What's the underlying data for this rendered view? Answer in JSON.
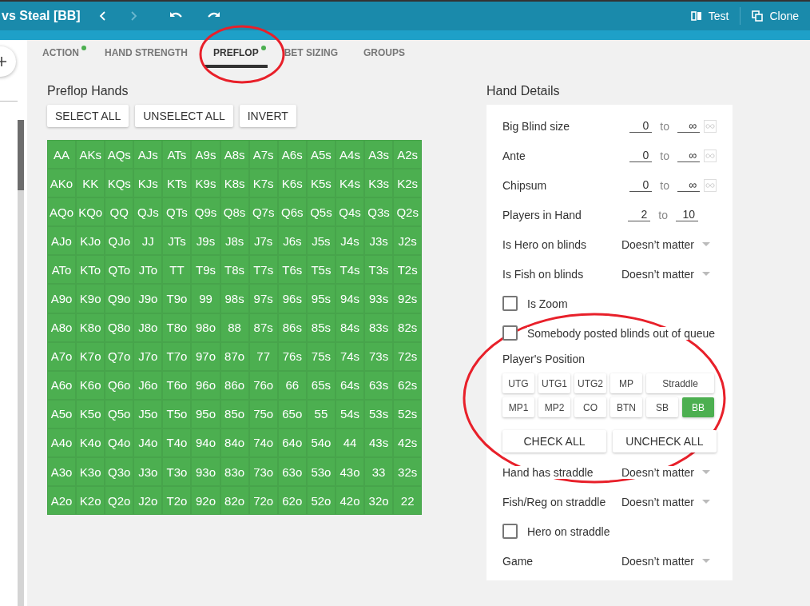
{
  "window": {
    "title": "vs Steal [BB]"
  },
  "toolbar": {
    "test": "Test",
    "clone": "Clone"
  },
  "tabs": [
    {
      "label": "ACTION",
      "dot": true,
      "selected": false
    },
    {
      "label": "HAND STRENGTH",
      "dot": false,
      "selected": false
    },
    {
      "label": "PREFLOP",
      "dot": true,
      "selected": true
    },
    {
      "label": "BET SIZING",
      "dot": false,
      "selected": false
    },
    {
      "label": "GROUPS",
      "dot": false,
      "selected": false
    }
  ],
  "hands_panel": {
    "title": "Preflop Hands",
    "buttons": [
      "SELECT ALL",
      "UNSELECT ALL",
      "INVERT"
    ],
    "rows": [
      {
        "cells": [
          {
            "label": "AA",
            "selected": true
          },
          {
            "label": "AKs",
            "selected": true
          },
          {
            "label": "AQs",
            "selected": true
          },
          {
            "label": "AJs",
            "selected": true
          },
          {
            "label": "ATs",
            "selected": true
          },
          {
            "label": "A9s",
            "selected": true
          },
          {
            "label": "A8s",
            "selected": true
          },
          {
            "label": "A7s",
            "selected": true
          },
          {
            "label": "A6s",
            "selected": true
          },
          {
            "label": "A5s",
            "selected": true
          },
          {
            "label": "A4s",
            "selected": true
          },
          {
            "label": "A3s",
            "selected": true
          },
          {
            "label": "A2s",
            "selected": true
          }
        ]
      },
      {
        "cells": [
          {
            "label": "AKo",
            "selected": true
          },
          {
            "label": "KK",
            "selected": true
          },
          {
            "label": "KQs",
            "selected": true
          },
          {
            "label": "KJs",
            "selected": true
          },
          {
            "label": "KTs",
            "selected": true
          },
          {
            "label": "K9s",
            "selected": true
          },
          {
            "label": "K8s",
            "selected": true
          },
          {
            "label": "K7s",
            "selected": true
          },
          {
            "label": "K6s",
            "selected": true
          },
          {
            "label": "K5s",
            "selected": true
          },
          {
            "label": "K4s",
            "selected": true
          },
          {
            "label": "K3s",
            "selected": true
          },
          {
            "label": "K2s",
            "selected": true
          }
        ]
      },
      {
        "cells": [
          {
            "label": "AQo",
            "selected": true
          },
          {
            "label": "KQo",
            "selected": true
          },
          {
            "label": "QQ",
            "selected": true
          },
          {
            "label": "QJs",
            "selected": true
          },
          {
            "label": "QTs",
            "selected": true
          },
          {
            "label": "Q9s",
            "selected": true
          },
          {
            "label": "Q8s",
            "selected": true
          },
          {
            "label": "Q7s",
            "selected": true
          },
          {
            "label": "Q6s",
            "selected": true
          },
          {
            "label": "Q5s",
            "selected": true
          },
          {
            "label": "Q4s",
            "selected": true
          },
          {
            "label": "Q3s",
            "selected": true
          },
          {
            "label": "Q2s",
            "selected": true
          }
        ]
      },
      {
        "cells": [
          {
            "label": "AJo",
            "selected": true
          },
          {
            "label": "KJo",
            "selected": true
          },
          {
            "label": "QJo",
            "selected": true
          },
          {
            "label": "JJ",
            "selected": true
          },
          {
            "label": "JTs",
            "selected": true
          },
          {
            "label": "J9s",
            "selected": true
          },
          {
            "label": "J8s",
            "selected": true
          },
          {
            "label": "J7s",
            "selected": true
          },
          {
            "label": "J6s",
            "selected": true
          },
          {
            "label": "J5s",
            "selected": true
          },
          {
            "label": "J4s",
            "selected": true
          },
          {
            "label": "J3s",
            "selected": true
          },
          {
            "label": "J2s",
            "selected": true
          }
        ]
      },
      {
        "cells": [
          {
            "label": "ATo",
            "selected": true
          },
          {
            "label": "KTo",
            "selected": true
          },
          {
            "label": "QTo",
            "selected": true
          },
          {
            "label": "JTo",
            "selected": true
          },
          {
            "label": "TT",
            "selected": true
          },
          {
            "label": "T9s",
            "selected": true
          },
          {
            "label": "T8s",
            "selected": true
          },
          {
            "label": "T7s",
            "selected": true
          },
          {
            "label": "T6s",
            "selected": true
          },
          {
            "label": "T5s",
            "selected": true
          },
          {
            "label": "T4s",
            "selected": true
          },
          {
            "label": "T3s",
            "selected": true
          },
          {
            "label": "T2s",
            "selected": true
          }
        ]
      },
      {
        "cells": [
          {
            "label": "A9o",
            "selected": true
          },
          {
            "label": "K9o",
            "selected": true
          },
          {
            "label": "Q9o",
            "selected": true
          },
          {
            "label": "J9o",
            "selected": true
          },
          {
            "label": "T9o",
            "selected": true
          },
          {
            "label": "99",
            "selected": true
          },
          {
            "label": "98s",
            "selected": true
          },
          {
            "label": "97s",
            "selected": true
          },
          {
            "label": "96s",
            "selected": true
          },
          {
            "label": "95s",
            "selected": true
          },
          {
            "label": "94s",
            "selected": true
          },
          {
            "label": "93s",
            "selected": true
          },
          {
            "label": "92s",
            "selected": true
          }
        ]
      },
      {
        "cells": [
          {
            "label": "A8o",
            "selected": true
          },
          {
            "label": "K8o",
            "selected": true
          },
          {
            "label": "Q8o",
            "selected": true
          },
          {
            "label": "J8o",
            "selected": true
          },
          {
            "label": "T8o",
            "selected": true
          },
          {
            "label": "98o",
            "selected": true
          },
          {
            "label": "88",
            "selected": true
          },
          {
            "label": "87s",
            "selected": true
          },
          {
            "label": "86s",
            "selected": true
          },
          {
            "label": "85s",
            "selected": true
          },
          {
            "label": "84s",
            "selected": true
          },
          {
            "label": "83s",
            "selected": true
          },
          {
            "label": "82s",
            "selected": true
          }
        ]
      },
      {
        "cells": [
          {
            "label": "A7o",
            "selected": true
          },
          {
            "label": "K7o",
            "selected": true
          },
          {
            "label": "Q7o",
            "selected": true
          },
          {
            "label": "J7o",
            "selected": true
          },
          {
            "label": "T7o",
            "selected": true
          },
          {
            "label": "97o",
            "selected": true
          },
          {
            "label": "87o",
            "selected": true
          },
          {
            "label": "77",
            "selected": true
          },
          {
            "label": "76s",
            "selected": true
          },
          {
            "label": "75s",
            "selected": true
          },
          {
            "label": "74s",
            "selected": true
          },
          {
            "label": "73s",
            "selected": true
          },
          {
            "label": "72s",
            "selected": true
          }
        ]
      },
      {
        "cells": [
          {
            "label": "A6o",
            "selected": true
          },
          {
            "label": "K6o",
            "selected": true
          },
          {
            "label": "Q6o",
            "selected": true
          },
          {
            "label": "J6o",
            "selected": true
          },
          {
            "label": "T6o",
            "selected": true
          },
          {
            "label": "96o",
            "selected": true
          },
          {
            "label": "86o",
            "selected": true
          },
          {
            "label": "76o",
            "selected": true
          },
          {
            "label": "66",
            "selected": true
          },
          {
            "label": "65s",
            "selected": true
          },
          {
            "label": "64s",
            "selected": true
          },
          {
            "label": "63s",
            "selected": true
          },
          {
            "label": "62s",
            "selected": true
          }
        ]
      },
      {
        "cells": [
          {
            "label": "A5o",
            "selected": true
          },
          {
            "label": "K5o",
            "selected": true
          },
          {
            "label": "Q5o",
            "selected": true
          },
          {
            "label": "J5o",
            "selected": true
          },
          {
            "label": "T5o",
            "selected": true
          },
          {
            "label": "95o",
            "selected": true
          },
          {
            "label": "85o",
            "selected": true
          },
          {
            "label": "75o",
            "selected": true
          },
          {
            "label": "65o",
            "selected": true
          },
          {
            "label": "55",
            "selected": true
          },
          {
            "label": "54s",
            "selected": true
          },
          {
            "label": "53s",
            "selected": true
          },
          {
            "label": "52s",
            "selected": true
          }
        ]
      },
      {
        "cells": [
          {
            "label": "A4o",
            "selected": true
          },
          {
            "label": "K4o",
            "selected": true
          },
          {
            "label": "Q4o",
            "selected": true
          },
          {
            "label": "J4o",
            "selected": true
          },
          {
            "label": "T4o",
            "selected": true
          },
          {
            "label": "94o",
            "selected": true
          },
          {
            "label": "84o",
            "selected": true
          },
          {
            "label": "74o",
            "selected": true
          },
          {
            "label": "64o",
            "selected": true
          },
          {
            "label": "54o",
            "selected": true
          },
          {
            "label": "44",
            "selected": true
          },
          {
            "label": "43s",
            "selected": true
          },
          {
            "label": "42s",
            "selected": true
          }
        ]
      },
      {
        "cells": [
          {
            "label": "A3o",
            "selected": true
          },
          {
            "label": "K3o",
            "selected": true
          },
          {
            "label": "Q3o",
            "selected": true
          },
          {
            "label": "J3o",
            "selected": true
          },
          {
            "label": "T3o",
            "selected": true
          },
          {
            "label": "93o",
            "selected": true
          },
          {
            "label": "83o",
            "selected": true
          },
          {
            "label": "73o",
            "selected": true
          },
          {
            "label": "63o",
            "selected": true
          },
          {
            "label": "53o",
            "selected": true
          },
          {
            "label": "43o",
            "selected": true
          },
          {
            "label": "33",
            "selected": true
          },
          {
            "label": "32s",
            "selected": true
          }
        ]
      },
      {
        "cells": [
          {
            "label": "A2o",
            "selected": true
          },
          {
            "label": "K2o",
            "selected": true
          },
          {
            "label": "Q2o",
            "selected": true
          },
          {
            "label": "J2o",
            "selected": true
          },
          {
            "label": "T2o",
            "selected": true
          },
          {
            "label": "92o",
            "selected": true
          },
          {
            "label": "82o",
            "selected": true
          },
          {
            "label": "72o",
            "selected": true
          },
          {
            "label": "62o",
            "selected": true
          },
          {
            "label": "52o",
            "selected": true
          },
          {
            "label": "42o",
            "selected": true
          },
          {
            "label": "32o",
            "selected": true
          },
          {
            "label": "22",
            "selected": true
          }
        ]
      }
    ]
  },
  "details": {
    "title": "Hand Details",
    "fields": [
      {
        "kind": "range",
        "label": "Big Blind size",
        "from": "0",
        "sep": "to",
        "to": "∞",
        "infinity_toggle": true
      },
      {
        "kind": "range",
        "label": "Ante",
        "from": "0",
        "sep": "to",
        "to": "∞",
        "infinity_toggle": true
      },
      {
        "kind": "range",
        "label": "Chipsum",
        "from": "0",
        "sep": "to",
        "to": "∞",
        "infinity_toggle": true
      },
      {
        "kind": "range",
        "label": "Players in Hand",
        "from": "2",
        "sep": "to",
        "to": "10",
        "infinity_toggle": false
      },
      {
        "kind": "select",
        "label": "Is Hero on blinds",
        "value": "Doesn’t matter"
      },
      {
        "kind": "select",
        "label": "Is Fish on blinds",
        "value": "Doesn’t matter"
      },
      {
        "kind": "checkbox",
        "label": "Is Zoom",
        "checked": false
      },
      {
        "kind": "checkbox",
        "label": "Somebody posted blinds out of queue",
        "checked": false
      },
      {
        "kind": "positions",
        "label": "Player's Position",
        "buttons": [
          {
            "label": "UTG",
            "selected": false,
            "wide": false
          },
          {
            "label": "UTG1",
            "selected": false,
            "wide": false
          },
          {
            "label": "UTG2",
            "selected": false,
            "wide": false
          },
          {
            "label": "MP",
            "selected": false,
            "wide": false
          },
          {
            "label": "Straddle",
            "selected": false,
            "wide": true
          },
          {
            "label": "MP1",
            "selected": false,
            "wide": false
          },
          {
            "label": "MP2",
            "selected": false,
            "wide": false
          },
          {
            "label": "CO",
            "selected": false,
            "wide": false
          },
          {
            "label": "BTN",
            "selected": false,
            "wide": false
          },
          {
            "label": "SB",
            "selected": false,
            "wide": false
          },
          {
            "label": "BB",
            "selected": true,
            "wide": false
          }
        ]
      },
      {
        "kind": "actions",
        "buttons": [
          "CHECK ALL",
          "UNCHECK ALL"
        ]
      },
      {
        "kind": "select",
        "label": "Hand has straddle",
        "value": "Doesn’t matter"
      },
      {
        "kind": "select",
        "label": "Fish/Reg on straddle",
        "value": "Doesn’t matter"
      },
      {
        "kind": "checkbox",
        "label": "Hero on straddle",
        "checked": false
      },
      {
        "kind": "select",
        "label": "Game",
        "value": "Doesn’t matter"
      }
    ]
  }
}
